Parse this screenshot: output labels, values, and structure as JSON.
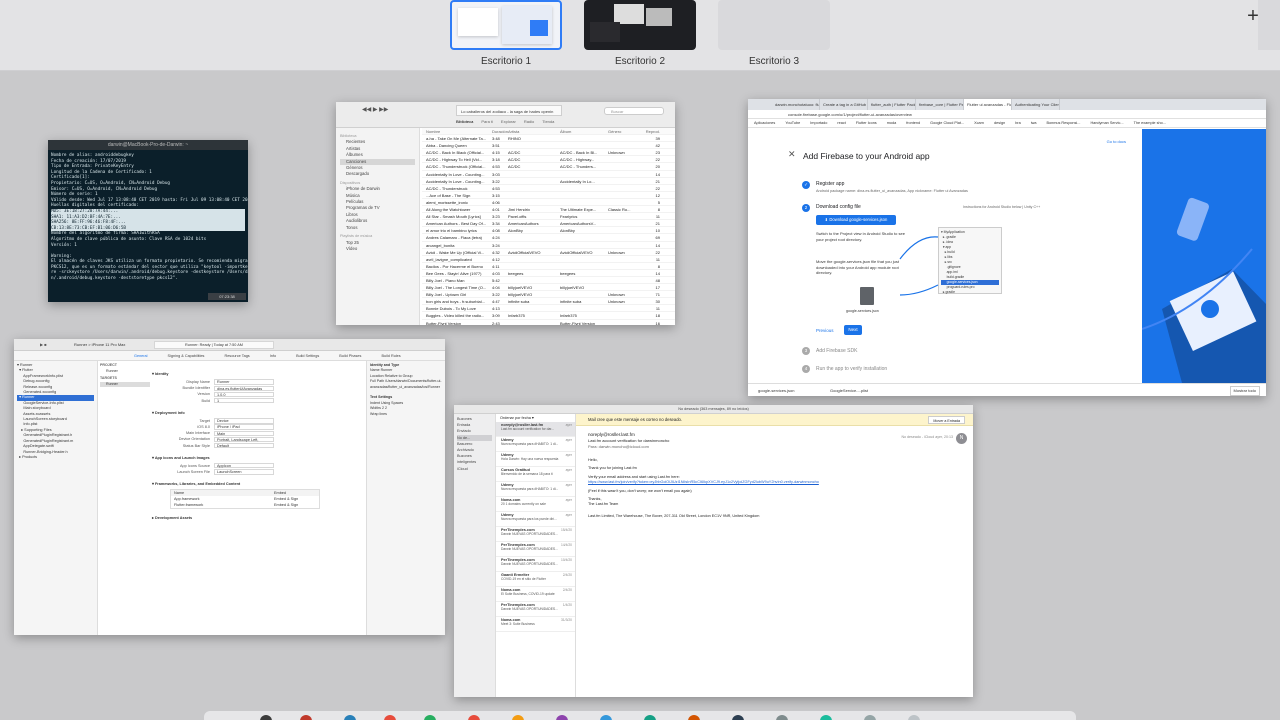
{
  "spaces": [
    {
      "label": "Escritorio 1",
      "active": true
    },
    {
      "label": "Escritorio 2",
      "active": false
    },
    {
      "label": "Escritorio 3",
      "active": false
    }
  ],
  "add_space_label": "+",
  "terminal": {
    "title": "darwin@MacBook-Pro-de-Darwin: ~",
    "lines": [
      "Nombre de alias: androiddebugkey",
      "Fecha de creación: 17/07/2019",
      "Tipo de Entrada: PrivateKeyEntry",
      "Longitud de la Cadena de Certificado: 1",
      "Certificado[1]:",
      "Propietario: C=US, O=Android, CN=Android Debug",
      "Emisor: C=US, O=Android, CN=Android Debug",
      "Número de serie: 1",
      "Válido desde: Wed Jul 17 13:08:40 CET 2019 hasta: Fri Jul 09 13:08:40 CET 2049",
      "Huellas digitales del certificado:",
      "     MD5: 3E:18:27:20:7A:44:...",
      "     SHA1: 11:A3:D2:BF:4A:7E:...",
      "     SHA256: 8E:FF:96:46:F8:4F:...",
      "CB:13:8E:73:CB:EF:B1:06:D6:5B",
      "Nombre del algoritmo de firma: SHA1withRSA",
      "Algoritmo de clave pública de asunto: Clave RSA de 1024 bits",
      "Versión: 1",
      "",
      "Warning:",
      "El almacén de claves JKS utiliza un formato propietario. Se recomienda migrar a",
      "PKCS12, que es un formato estándar del sector que utiliza \"keytool -importkeysto",
      "re -srckeystore /Users/darwin/.android/debug.keystore -destkeystore /Users/darwi",
      "n/.android/debug.keystore -deststoretype pkcs12\"."
    ],
    "status": "07:23:38"
  },
  "itunes": {
    "now_playing": "Lo caballeros del zodiaco - la saga de hades openin",
    "search_placeholder": "Buscar",
    "tabs": [
      "Biblioteca",
      "Para ti",
      "Explorar",
      "Radio",
      "Tienda"
    ],
    "sidebar": [
      {
        "text": "Biblioteca",
        "header": true
      },
      {
        "text": "Recientes"
      },
      {
        "text": "Artistas"
      },
      {
        "text": "Álbumes"
      },
      {
        "text": "Canciones",
        "selected": true
      },
      {
        "text": "Géneros"
      },
      {
        "text": "Descargado"
      },
      {
        "text": "Dispositivos",
        "header": true
      },
      {
        "text": "iPhone de Darwin"
      },
      {
        "text": "Música"
      },
      {
        "text": "Películas"
      },
      {
        "text": "Programas de TV"
      },
      {
        "text": "Libros"
      },
      {
        "text": "Audiolibros"
      },
      {
        "text": "Tonos"
      },
      {
        "text": "Playlists de música",
        "header": true
      },
      {
        "text": "Top 25"
      },
      {
        "text": "Vídeo"
      }
    ],
    "columns": [
      "Nombre",
      "Duración",
      "Artista",
      "Álbum",
      "Género",
      "Reprod."
    ],
    "rows": [
      [
        "a-ha - Take On Me (Alternate Ta...",
        "3:48",
        "RHINO",
        "",
        "",
        "39"
      ],
      [
        "Abba - Dancing Queen",
        "3:51",
        "",
        "",
        "",
        "42"
      ],
      [
        "AC/DC - Back In Black (Official...",
        "4:15",
        "AC/DC",
        "AC/DC - Back In Bl...",
        "Unknown",
        "23"
      ],
      [
        "AC/DC - Highway To Hell (Vid...",
        "3:18",
        "AC/DC",
        "AC/DC - Highway...",
        "",
        "22"
      ],
      [
        "AC/DC - Thunderstruck (Official...",
        "4:53",
        "AC/DC",
        "AC/DC - Thunders...",
        "",
        "20"
      ],
      [
        "Accidentally In Love - Counting...",
        "3:03",
        "",
        "",
        "",
        "14"
      ],
      [
        "Accidentally In Love - Counting...",
        "3:22",
        "",
        "Accidentally In Lo...",
        "",
        "21"
      ],
      [
        "AC/DC - Thunderstruck",
        "4:53",
        "",
        "",
        "",
        "22"
      ],
      [
        "...Ace of Base - The Sign",
        "3:15",
        "",
        "",
        "",
        "12"
      ],
      [
        "alemi_morissette_ironic",
        "4:06",
        "",
        "",
        "",
        "5"
      ],
      [
        "All Along the Watchtower",
        "4:01",
        "Jimi Hendrix",
        "The Ultimate Expe...",
        "Classic Ro...",
        "8"
      ],
      [
        "All Star - Smash Mouth [Lyrics]",
        "3:23",
        "Pavel.offis",
        "Fearlyrics",
        "",
        "11"
      ],
      [
        "American Authors - Best Day Of...",
        "3:34",
        "AmericanAuthors",
        "AmericanAuthorsV...",
        "",
        "21"
      ],
      [
        "el amor trio el bambino lyrics",
        "4:08",
        "AlonBby",
        "AlonBby",
        "",
        "10"
      ],
      [
        "Andres Calamaro - Flaca (letra)",
        "4:24",
        "",
        "",
        "",
        "69"
      ],
      [
        "arcangel_bonita",
        "3:24",
        "",
        "",
        "",
        "14"
      ],
      [
        "Avicii - Wake Me Up (Official Vi...",
        "4:32",
        "AviciiOfficialVEVO",
        "AviciiOfficialVEVO",
        "Unknown",
        "22"
      ],
      [
        "avril_lavigne_complicated",
        "4:12",
        "",
        "",
        "",
        "11"
      ],
      [
        "Bacilos - Por Hacerme el Bueno",
        "4:11",
        "",
        "",
        "",
        "8"
      ],
      [
        "Bee Gees - Stayin' Alive (1977)",
        "4:03",
        "beegees",
        "beegees",
        "",
        "14"
      ],
      [
        "Billy Joel - Piano Man",
        "5:42",
        "",
        "",
        "",
        "48"
      ],
      [
        "Billy Joel - The Longest Time (O...",
        "4:04",
        "billyjoelVEVO",
        "billyjoelVEVO",
        "",
        "17"
      ],
      [
        "Billy Joel - Uptown Girl",
        "3:22",
        "billyjoelVEVO",
        "",
        "Unknown",
        "71"
      ],
      [
        "bon girls and boys - fr.suburbial...",
        "4:47",
        "infinite suba",
        "infinite suba",
        "Unknown",
        "30"
      ],
      [
        "Bonnie Dubois - To My Love",
        "4:13",
        "",
        "",
        "",
        "11"
      ],
      [
        "Buggles - Video killed the radio...",
        "3:09",
        "Infarb375",
        "Infarb375",
        "",
        "18"
      ],
      [
        "Butter-Flynt Version",
        "2:43",
        "",
        "Butter-Flynt Version",
        "",
        "16"
      ],
      [
        "butterfly (Flynt version) BPM (W...",
        "4:53",
        "",
        "",
        "",
        "20"
      ]
    ]
  },
  "chrome": {
    "tabs": [
      "darwin.monchotatuoo: flutter",
      "Create a tag in a GitHub",
      "flutter_auth | Flutter Package",
      "firebase_core | Flutter Package",
      "Flutter ui avanzadas - Flutter",
      "Authenticating Your Client"
    ],
    "url": "console.firebase.google.com/u/1/project/flutter-ui-avanzadas/overview",
    "bookmarks": [
      "Aplicaciones",
      "YouTube",
      "Importado",
      "react",
      "Flutter Icons",
      "moda",
      "frontend",
      "Google Cloud Plat...",
      "Xcarn",
      "design",
      "bra",
      "iwa",
      "Bonmus Responsi...",
      "Handyman Servic...",
      "The example sho..."
    ],
    "firebase": {
      "title": "Add Firebase to your Android app",
      "go_to_docs": "Go to docs",
      "steps": [
        {
          "num": "✓",
          "label": "Register app",
          "sub": "Android package name: dina.es.flutter_ui_avanzadas, App nickname: Flutter ui Avanzadas"
        },
        {
          "num": "2",
          "label": "Download config file",
          "sub": ""
        },
        {
          "num": "3",
          "label": "Add Firebase SDK",
          "sub": ""
        },
        {
          "num": "4",
          "label": "Run the app to verify installation",
          "sub": ""
        }
      ],
      "download_button": "⬇ Download google-services.json",
      "instructions_for": "Instructions for Android Studio below  |  Unity  C++",
      "text1": "Switch to the Project view in Android Studio to see your project root directory.",
      "text2": "Move the google-services.json file that you just downloaded into your Android app module root directory.",
      "file_label": "google-services.json",
      "tree": [
        "▾ MyApplication",
        "  ▸ .gradle",
        "  ▸ .idea",
        "  ▾ app",
        "    ▸ build",
        "    ▸ libs",
        "    ▸ src",
        "      .gitignore",
        "      app.iml",
        "      build.gradle",
        "      google-services.json",
        "      proguard-rules.pro",
        "  ▸ gradle"
      ],
      "previous": "Previous",
      "next": "Next"
    },
    "downloads": [
      {
        "name": "google-services.json"
      },
      {
        "name": "GoogleService-...plist"
      }
    ],
    "show_all": "Mostrar todo"
  },
  "xcode": {
    "toolbar_status": "Runner: Ready | Today at 7:50 AM",
    "scheme": "Runner  >  iPhone 11 Pro Max",
    "tabs": [
      "General",
      "Signing & Capabilities",
      "Resource Tags",
      "Info",
      "Build Settings",
      "Build Phases",
      "Build Rules"
    ],
    "navigator": [
      {
        "text": "▾ Runner"
      },
      {
        "text": "  ▾ Flutter"
      },
      {
        "text": "      AppFrameworkInfo.plist"
      },
      {
        "text": "      Debug.xcconfig"
      },
      {
        "text": "      Release.xcconfig"
      },
      {
        "text": "      Generated.xcconfig"
      },
      {
        "text": "  ▾ Runner",
        "selected": true
      },
      {
        "text": "      GoogleService-Info.plist"
      },
      {
        "text": "      Main.storyboard"
      },
      {
        "text": "      Assets.xcassets"
      },
      {
        "text": "      LaunchScreen.storyboard"
      },
      {
        "text": "      Info.plist"
      },
      {
        "text": "    ▸ Supporting Files"
      },
      {
        "text": "      GeneratedPluginRegistrant.h"
      },
      {
        "text": "      GeneratedPluginRegistrant.m"
      },
      {
        "text": "      AppDelegate.swift"
      },
      {
        "text": "      Runner-Bridging-Header.h"
      },
      {
        "text": "  ▸ Products"
      }
    ],
    "project_label": "PROJECT",
    "project_item": "Runner",
    "targets_label": "TARGETS",
    "target_item": "Runner",
    "identity": {
      "section": "Identity",
      "fields": [
        {
          "label": "Display Name",
          "value": "Runner"
        },
        {
          "label": "Bundle Identifier",
          "value": "dina.es.flutterUiAvanzadas"
        },
        {
          "label": "Version",
          "value": "1.0.0"
        },
        {
          "label": "Build",
          "value": "1"
        }
      ]
    },
    "deployment": {
      "section": "Deployment Info",
      "fields": [
        {
          "label": "Target",
          "value": "Device"
        },
        {
          "label": "iOS 8.0",
          "value": "iPhone / iPad"
        },
        {
          "label": "Main Interface",
          "value": "Main"
        },
        {
          "label": "Device Orientation",
          "value": "Portrait, Landscape Left, Landscape Right"
        },
        {
          "label": "Status Bar Style",
          "value": "Default"
        }
      ]
    },
    "app_icons": {
      "section": "App Icons and Launch Images",
      "fields": [
        {
          "label": "App Icons Source",
          "value": "AppIcon"
        },
        {
          "label": "Launch Screen File",
          "value": "LaunchScreen"
        }
      ]
    },
    "frameworks": {
      "section": "Frameworks, Libraries, and Embedded Content",
      "columns": [
        "Name",
        "Embed"
      ],
      "rows": [
        [
          "App.framework",
          "Embed & Sign"
        ],
        [
          "Flutter.framework",
          "Embed & Sign"
        ]
      ]
    },
    "dev_assets": "Development Assets",
    "inspector": [
      {
        "text": "Identity and Type",
        "bold": true
      },
      {
        "text": "Name  Runner"
      },
      {
        "text": "Location  Relative to Group"
      },
      {
        "text": "Full Path  /Users/darwin/Documents/flutter-ui-avanzadas/flutter_ui_avanzadas/ios/Runner"
      },
      {
        "text": ""
      },
      {
        "text": "Text Settings",
        "bold": true
      },
      {
        "text": "Indent Using  Spaces"
      },
      {
        "text": "Widths  2   2"
      },
      {
        "text": "Wrap lines"
      }
    ]
  },
  "mail": {
    "title": "No deseado (363 mensajes, 89 no leídos)",
    "sidebar": [
      {
        "text": "Buzones"
      },
      {
        "text": "Entrada"
      },
      {
        "text": "Enviado"
      },
      {
        "text": "No de...",
        "selected": true
      },
      {
        "text": "Basurero"
      },
      {
        "text": "Archivado"
      },
      {
        "text": "Buzones inteligentes"
      },
      {
        "text": "iCloud"
      }
    ],
    "sort": "Ordenar por fecha ▾",
    "messages": [
      {
        "from": "noreply@rosller.last.fm",
        "date": "ayer",
        "subject": "Last.fm account verification for dar...",
        "selected": true
      },
      {
        "from": "Udemy",
        "date": "ayer",
        "subject": "Nueva respuesta para #HABITO: 1 di..."
      },
      {
        "from": "Udemy",
        "date": "ayer",
        "subject": "Hola Darwin: Hay una nueva respuesta"
      },
      {
        "from": "Cursos Gratitud",
        "date": "ayer",
        "subject": "Bienvenido de la semana 18 para ti"
      },
      {
        "from": "Udemy",
        "date": "ayer",
        "subject": "Nueva respuesta para #HABITO: 1 di..."
      },
      {
        "from": "Noma.com",
        "date": "ayer",
        "subject": "20 1 domains currently on sale"
      },
      {
        "from": "Udemy",
        "date": "ayer",
        "subject": "Nueva respuesta para los puede dirí..."
      },
      {
        "from": "PerTinemples.com",
        "date": "15/4/20",
        "subject": "Darwin NUEVAS OPORTUNIDADES..."
      },
      {
        "from": "PerTinemples.com",
        "date": "14/4/20",
        "subject": "Darwin NUEVAS OPORTUNIDADES..."
      },
      {
        "from": "PerTinemples.com",
        "date": "10/4/20",
        "subject": "Darwin NUEVAS OPORTUNIDADES..."
      },
      {
        "from": "Gaanti Ermelter",
        "date": "2/4/20",
        "subject": "COVID-19 en el sitio de Flutter"
      },
      {
        "from": "Noma.com",
        "date": "2/4/20",
        "subject": "El Suite Business, COVID-19 update"
      },
      {
        "from": "PerTinemples.com",
        "date": "1/4/20",
        "subject": "Darwin NUEVAS OPORTUNIDADES..."
      },
      {
        "from": "Noma.com",
        "date": "31/3/20",
        "subject": "Meet 3: Suite Business"
      }
    ],
    "banner": "Mail cree que este mensaje es correo no deseado.",
    "move_button": "Mover a Entrada",
    "header": {
      "from": "noreply@rosller.last.fm",
      "subject": "Last.fm account verification for darwinmoncho",
      "to": "Para: darwin.moncho@icloud.com",
      "meta": "No deseado - iCloud    ayer, 20:13",
      "avatar": "N"
    },
    "body": {
      "greeting": "Hello,",
      "thanks": "Thank you for joining Last.fm",
      "verify": "Verify your email address and start using Last.fm here:",
      "link": "https://www.last.fm/join/verify?token=eyJhbGciOiJIUzI1NiIsInR5cCI6IkpXVCJ9.eyJ1c2VyIjoiZGFyd2lubW9uY2hvIn0.verify-darwinmoncho",
      "ignore": "(Feel if this wasn't you, don't worry; we won't email you again)",
      "signoff": "Thanks,",
      "team": "The Last.fm Team",
      "footer": "Last.fm Limited, The Warehouse, The Boxer, 207-311 Old Street, London EC1V 9NR, United Kingdom"
    }
  },
  "colors": {
    "accent": "#2f7cf6",
    "firebase_blue": "#1a73e8",
    "terminal_bg": "#0b1f2a",
    "mail_banner": "#fdf4cc"
  }
}
